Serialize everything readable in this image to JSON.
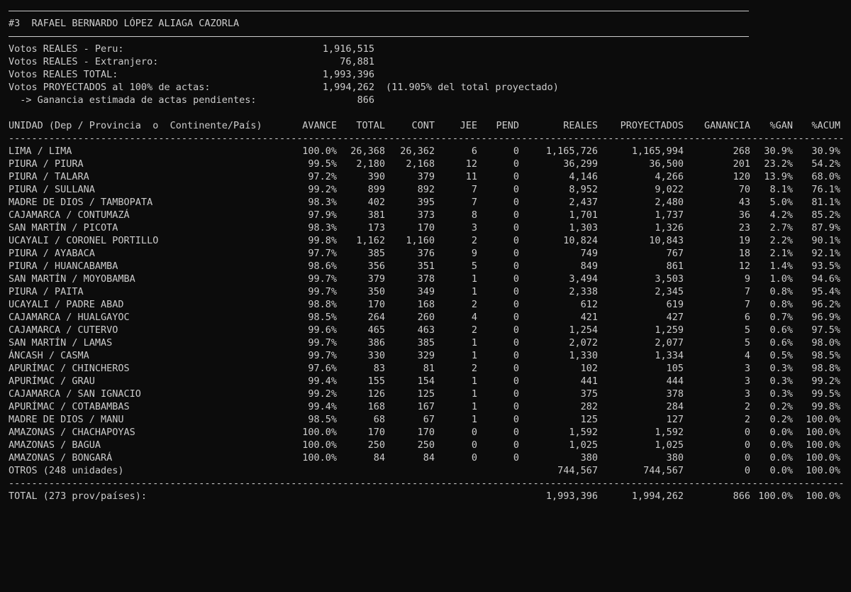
{
  "header": {
    "title": "#3  RAFAEL BERNARDO LÓPEZ ALIAGA CAZORLA"
  },
  "summary": [
    {
      "label": "Votos REALES - Peru:",
      "value": "1,916,515",
      "note": ""
    },
    {
      "label": "Votos REALES - Extranjero:",
      "value": "76,881",
      "note": ""
    },
    {
      "label": "Votos REALES TOTAL:",
      "value": "1,993,396",
      "note": ""
    },
    {
      "label": "Votos PROYECTADOS al 100% de actas:",
      "value": "1,994,262",
      "note": "(11.905% del total proyectado)"
    },
    {
      "label": "  -> Ganancia estimada de actas pendientes:",
      "value": "866",
      "note": ""
    }
  ],
  "table": {
    "headers": {
      "unit": "UNIDAD (Dep / Provincia  o  Continente/País)",
      "avance": "AVANCE",
      "total": "TOTAL",
      "cont": "CONT",
      "jee": "JEE",
      "pend": "PEND",
      "reales": "REALES",
      "proy": "PROYECTADOS",
      "gan": "GANANCIA",
      "pgan": "%GAN",
      "pacum": "%ACUM"
    },
    "separator": "----------------------------------------------------------------------------------------------------------------------------------------------------------------------------------------",
    "rows": [
      {
        "unit": "LIMA / LIMA",
        "avance": "100.0%",
        "total": "26,368",
        "cont": "26,362",
        "jee": "6",
        "pend": "0",
        "reales": "1,165,726",
        "proy": "1,165,994",
        "gan": "268",
        "pgan": "30.9%",
        "pacum": "30.9%"
      },
      {
        "unit": "PIURA / PIURA",
        "avance": "99.5%",
        "total": "2,180",
        "cont": "2,168",
        "jee": "12",
        "pend": "0",
        "reales": "36,299",
        "proy": "36,500",
        "gan": "201",
        "pgan": "23.2%",
        "pacum": "54.2%"
      },
      {
        "unit": "PIURA / TALARA",
        "avance": "97.2%",
        "total": "390",
        "cont": "379",
        "jee": "11",
        "pend": "0",
        "reales": "4,146",
        "proy": "4,266",
        "gan": "120",
        "pgan": "13.9%",
        "pacum": "68.0%"
      },
      {
        "unit": "PIURA / SULLANA",
        "avance": "99.2%",
        "total": "899",
        "cont": "892",
        "jee": "7",
        "pend": "0",
        "reales": "8,952",
        "proy": "9,022",
        "gan": "70",
        "pgan": "8.1%",
        "pacum": "76.1%"
      },
      {
        "unit": "MADRE DE DIOS / TAMBOPATA",
        "avance": "98.3%",
        "total": "402",
        "cont": "395",
        "jee": "7",
        "pend": "0",
        "reales": "2,437",
        "proy": "2,480",
        "gan": "43",
        "pgan": "5.0%",
        "pacum": "81.1%"
      },
      {
        "unit": "CAJAMARCA / CONTUMAZÁ",
        "avance": "97.9%",
        "total": "381",
        "cont": "373",
        "jee": "8",
        "pend": "0",
        "reales": "1,701",
        "proy": "1,737",
        "gan": "36",
        "pgan": "4.2%",
        "pacum": "85.2%"
      },
      {
        "unit": "SAN MARTÍN / PICOTA",
        "avance": "98.3%",
        "total": "173",
        "cont": "170",
        "jee": "3",
        "pend": "0",
        "reales": "1,303",
        "proy": "1,326",
        "gan": "23",
        "pgan": "2.7%",
        "pacum": "87.9%"
      },
      {
        "unit": "UCAYALI / CORONEL PORTILLO",
        "avance": "99.8%",
        "total": "1,162",
        "cont": "1,160",
        "jee": "2",
        "pend": "0",
        "reales": "10,824",
        "proy": "10,843",
        "gan": "19",
        "pgan": "2.2%",
        "pacum": "90.1%"
      },
      {
        "unit": "PIURA / AYABACA",
        "avance": "97.7%",
        "total": "385",
        "cont": "376",
        "jee": "9",
        "pend": "0",
        "reales": "749",
        "proy": "767",
        "gan": "18",
        "pgan": "2.1%",
        "pacum": "92.1%"
      },
      {
        "unit": "PIURA / HUANCABAMBA",
        "avance": "98.6%",
        "total": "356",
        "cont": "351",
        "jee": "5",
        "pend": "0",
        "reales": "849",
        "proy": "861",
        "gan": "12",
        "pgan": "1.4%",
        "pacum": "93.5%"
      },
      {
        "unit": "SAN MARTÍN / MOYOBAMBA",
        "avance": "99.7%",
        "total": "379",
        "cont": "378",
        "jee": "1",
        "pend": "0",
        "reales": "3,494",
        "proy": "3,503",
        "gan": "9",
        "pgan": "1.0%",
        "pacum": "94.6%"
      },
      {
        "unit": "PIURA / PAITA",
        "avance": "99.7%",
        "total": "350",
        "cont": "349",
        "jee": "1",
        "pend": "0",
        "reales": "2,338",
        "proy": "2,345",
        "gan": "7",
        "pgan": "0.8%",
        "pacum": "95.4%"
      },
      {
        "unit": "UCAYALI / PADRE ABAD",
        "avance": "98.8%",
        "total": "170",
        "cont": "168",
        "jee": "2",
        "pend": "0",
        "reales": "612",
        "proy": "619",
        "gan": "7",
        "pgan": "0.8%",
        "pacum": "96.2%"
      },
      {
        "unit": "CAJAMARCA / HUALGAYOC",
        "avance": "98.5%",
        "total": "264",
        "cont": "260",
        "jee": "4",
        "pend": "0",
        "reales": "421",
        "proy": "427",
        "gan": "6",
        "pgan": "0.7%",
        "pacum": "96.9%"
      },
      {
        "unit": "CAJAMARCA / CUTERVO",
        "avance": "99.6%",
        "total": "465",
        "cont": "463",
        "jee": "2",
        "pend": "0",
        "reales": "1,254",
        "proy": "1,259",
        "gan": "5",
        "pgan": "0.6%",
        "pacum": "97.5%"
      },
      {
        "unit": "SAN MARTÍN / LAMAS",
        "avance": "99.7%",
        "total": "386",
        "cont": "385",
        "jee": "1",
        "pend": "0",
        "reales": "2,072",
        "proy": "2,077",
        "gan": "5",
        "pgan": "0.6%",
        "pacum": "98.0%"
      },
      {
        "unit": "ÁNCASH / CASMA",
        "avance": "99.7%",
        "total": "330",
        "cont": "329",
        "jee": "1",
        "pend": "0",
        "reales": "1,330",
        "proy": "1,334",
        "gan": "4",
        "pgan": "0.5%",
        "pacum": "98.5%"
      },
      {
        "unit": "APURÍMAC / CHINCHEROS",
        "avance": "97.6%",
        "total": "83",
        "cont": "81",
        "jee": "2",
        "pend": "0",
        "reales": "102",
        "proy": "105",
        "gan": "3",
        "pgan": "0.3%",
        "pacum": "98.8%"
      },
      {
        "unit": "APURÍMAC / GRAU",
        "avance": "99.4%",
        "total": "155",
        "cont": "154",
        "jee": "1",
        "pend": "0",
        "reales": "441",
        "proy": "444",
        "gan": "3",
        "pgan": "0.3%",
        "pacum": "99.2%"
      },
      {
        "unit": "CAJAMARCA / SAN IGNACIO",
        "avance": "99.2%",
        "total": "126",
        "cont": "125",
        "jee": "1",
        "pend": "0",
        "reales": "375",
        "proy": "378",
        "gan": "3",
        "pgan": "0.3%",
        "pacum": "99.5%"
      },
      {
        "unit": "APURÍMAC / COTABAMBAS",
        "avance": "99.4%",
        "total": "168",
        "cont": "167",
        "jee": "1",
        "pend": "0",
        "reales": "282",
        "proy": "284",
        "gan": "2",
        "pgan": "0.2%",
        "pacum": "99.8%"
      },
      {
        "unit": "MADRE DE DIOS / MANU",
        "avance": "98.5%",
        "total": "68",
        "cont": "67",
        "jee": "1",
        "pend": "0",
        "reales": "125",
        "proy": "127",
        "gan": "2",
        "pgan": "0.2%",
        "pacum": "100.0%"
      },
      {
        "unit": "AMAZONAS / CHACHAPOYAS",
        "avance": "100.0%",
        "total": "170",
        "cont": "170",
        "jee": "0",
        "pend": "0",
        "reales": "1,592",
        "proy": "1,592",
        "gan": "0",
        "pgan": "0.0%",
        "pacum": "100.0%"
      },
      {
        "unit": "AMAZONAS / BAGUA",
        "avance": "100.0%",
        "total": "250",
        "cont": "250",
        "jee": "0",
        "pend": "0",
        "reales": "1,025",
        "proy": "1,025",
        "gan": "0",
        "pgan": "0.0%",
        "pacum": "100.0%"
      },
      {
        "unit": "AMAZONAS / BONGARÁ",
        "avance": "100.0%",
        "total": "84",
        "cont": "84",
        "jee": "0",
        "pend": "0",
        "reales": "380",
        "proy": "380",
        "gan": "0",
        "pgan": "0.0%",
        "pacum": "100.0%"
      },
      {
        "unit": "OTROS (248 unidades)",
        "avance": "",
        "total": "",
        "cont": "",
        "jee": "",
        "pend": "",
        "reales": "744,567",
        "proy": "744,567",
        "gan": "0",
        "pgan": "0.0%",
        "pacum": "100.0%"
      }
    ],
    "total_row": {
      "unit": "TOTAL (273 prov/países):",
      "reales": "1,993,396",
      "proy": "1,994,262",
      "gan": "866",
      "pgan": "100.0%",
      "pacum": "100.0%"
    }
  }
}
